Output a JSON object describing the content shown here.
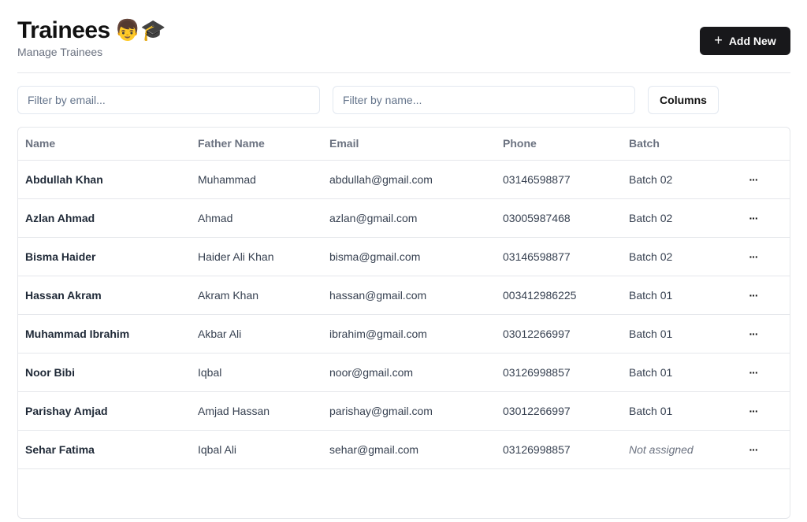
{
  "header": {
    "title": "Trainees",
    "emoji": "👦🎓",
    "subtitle": "Manage Trainees",
    "add_label": "Add New"
  },
  "filters": {
    "email_placeholder": "Filter by email...",
    "name_placeholder": "Filter by name...",
    "columns_label": "Columns"
  },
  "table": {
    "headers": [
      "Name",
      "Father Name",
      "Email",
      "Phone",
      "Batch"
    ],
    "rows": [
      {
        "name": "Abdullah Khan",
        "father": "Muhammad",
        "email": "abdullah@gmail.com",
        "phone": "03146598877",
        "batch": "Batch 02"
      },
      {
        "name": "Azlan Ahmad",
        "father": "Ahmad",
        "email": "azlan@gmail.com",
        "phone": "03005987468",
        "batch": "Batch 02"
      },
      {
        "name": "Bisma Haider",
        "father": "Haider Ali Khan",
        "email": "bisma@gmail.com",
        "phone": "03146598877",
        "batch": "Batch 02"
      },
      {
        "name": "Hassan Akram",
        "father": "Akram Khan",
        "email": "hassan@gmail.com",
        "phone": "003412986225",
        "batch": "Batch 01"
      },
      {
        "name": "Muhammad Ibrahim",
        "father": "Akbar Ali",
        "email": "ibrahim@gmail.com",
        "phone": "03012266997",
        "batch": "Batch 01"
      },
      {
        "name": "Noor Bibi",
        "father": "Iqbal",
        "email": "noor@gmail.com",
        "phone": "03126998857",
        "batch": "Batch 01"
      },
      {
        "name": "Parishay Amjad",
        "father": "Amjad Hassan",
        "email": "parishay@gmail.com",
        "phone": "03012266997",
        "batch": "Batch 01"
      },
      {
        "name": "Sehar Fatima",
        "father": "Iqbal Ali",
        "email": "sehar@gmail.com",
        "phone": "03126998857",
        "batch": "Not assigned"
      }
    ],
    "actions_icon": "···"
  }
}
